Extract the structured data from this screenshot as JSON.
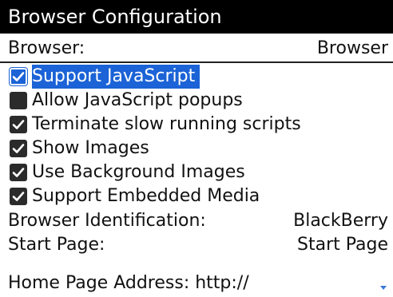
{
  "window": {
    "title": "Browser Configuration"
  },
  "browser": {
    "label": "Browser:",
    "value": "Browser"
  },
  "options": [
    {
      "label": "Support JavaScript",
      "checked": true,
      "focused": true
    },
    {
      "label": "Allow JavaScript popups",
      "checked": false,
      "focused": false
    },
    {
      "label": "Terminate slow running scripts",
      "checked": true,
      "focused": false
    },
    {
      "label": "Show Images",
      "checked": true,
      "focused": false
    },
    {
      "label": "Use Background Images",
      "checked": true,
      "focused": false
    },
    {
      "label": "Support Embedded Media",
      "checked": true,
      "focused": false
    }
  ],
  "browser_identification": {
    "label": "Browser Identification:",
    "value": "BlackBerry"
  },
  "start_page": {
    "label": "Start Page:",
    "value": "Start Page"
  },
  "home_page_address": {
    "label": "Home Page Address: http://"
  },
  "icons": {
    "checkbox": "checkmark-icon",
    "scroll": "scroll-down-arrow-icon"
  },
  "colors": {
    "titlebar_bg": "#000000",
    "focus_highlight": "#1b63d6",
    "checkbox_fill": "#2b2b2b"
  }
}
